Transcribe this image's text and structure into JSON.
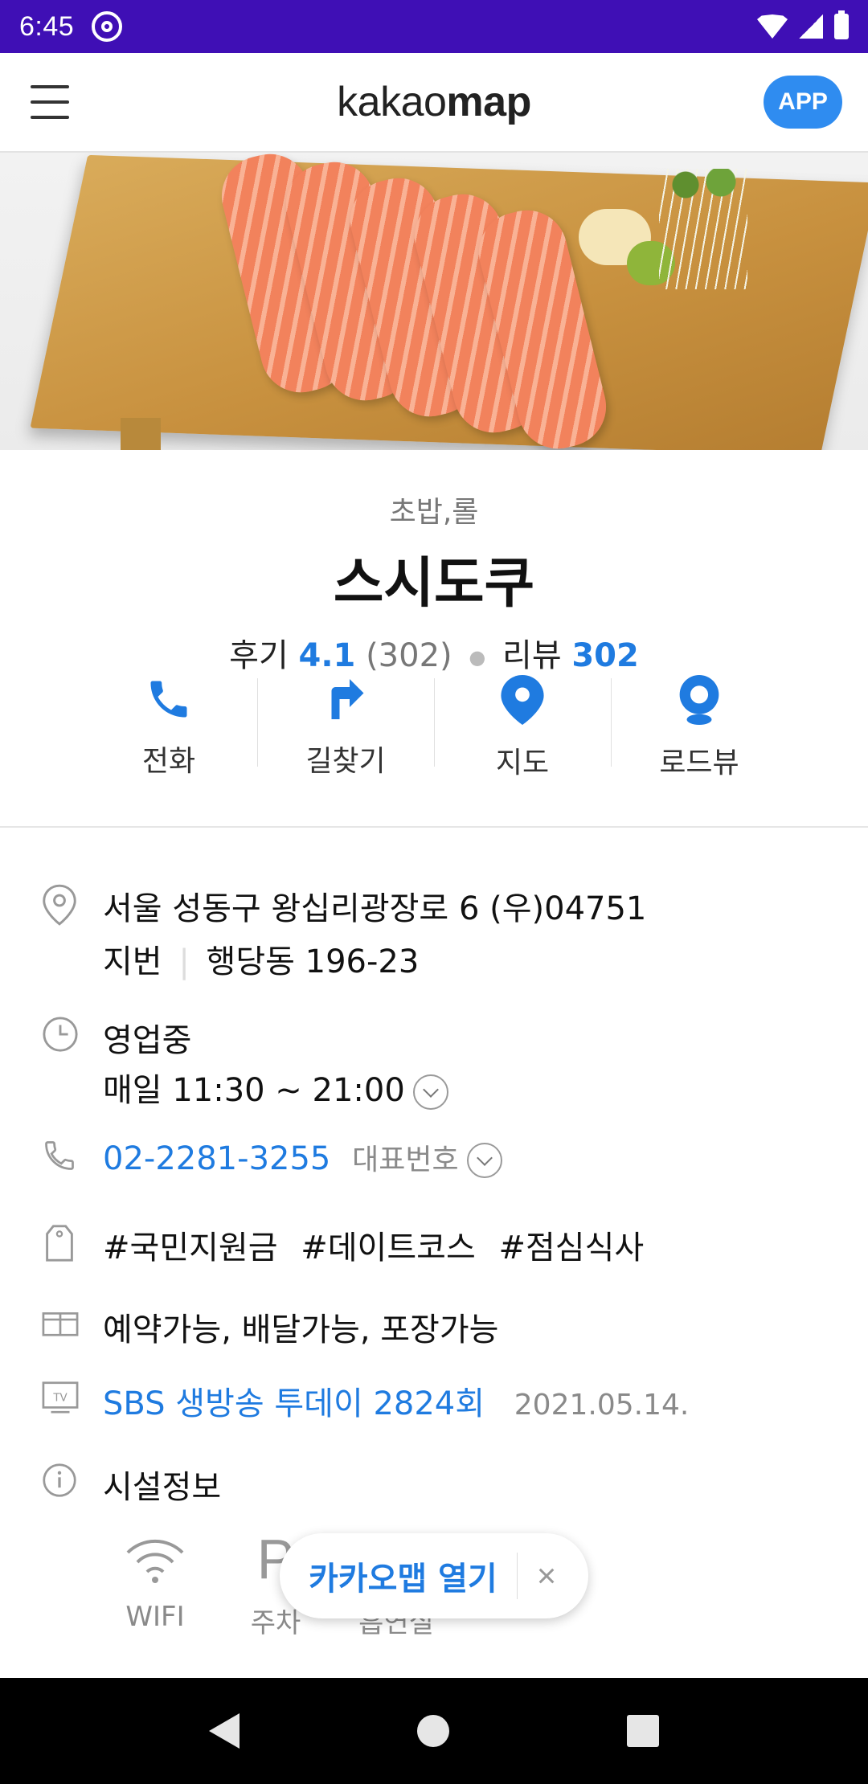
{
  "status_bar": {
    "time": "6:45"
  },
  "app_bar": {
    "logo_light": "kakao",
    "logo_bold": "map",
    "app_button": "APP"
  },
  "place": {
    "category": "초밥,롤",
    "name": "스시도쿠",
    "review_label": "후기",
    "review_score": "4.1",
    "review_count": "(302)",
    "blog_label": "리뷰",
    "blog_count": "302"
  },
  "actions": [
    {
      "label": "전화",
      "icon": "phone-icon"
    },
    {
      "label": "길찾기",
      "icon": "directions-icon"
    },
    {
      "label": "지도",
      "icon": "map-pin-icon"
    },
    {
      "label": "로드뷰",
      "icon": "roadview-icon"
    }
  ],
  "details": {
    "address": "서울 성동구 왕십리광장로 6 (우)04751",
    "lot_label": "지번",
    "lot_address": "행당동 196-23",
    "open_status": "영업중",
    "hours": "매일 11:30 ~ 21:00",
    "phone": "02-2281-3255",
    "phone_label": "대표번호",
    "tags": [
      "#국민지원금",
      "#데이트코스",
      "#점심식사"
    ],
    "services": "예약가능, 배달가능, 포장가능",
    "tv_show": "SBS 생방송 투데이 2824회",
    "tv_date": "2021.05.14.",
    "facility_title": "시설정보"
  },
  "facilities": [
    {
      "label": "WIFI",
      "icon": "wifi-icon"
    },
    {
      "label": "주차",
      "icon": "parking-icon"
    },
    {
      "label": "흡연실",
      "icon": "smoking-room-icon"
    }
  ],
  "open_app_pill": {
    "label": "카카오맵 열기",
    "close": "×"
  },
  "colors": {
    "status_bar": "#3f0fb5",
    "accent_blue": "#1f7be0",
    "open_green": "#2aa25a"
  }
}
